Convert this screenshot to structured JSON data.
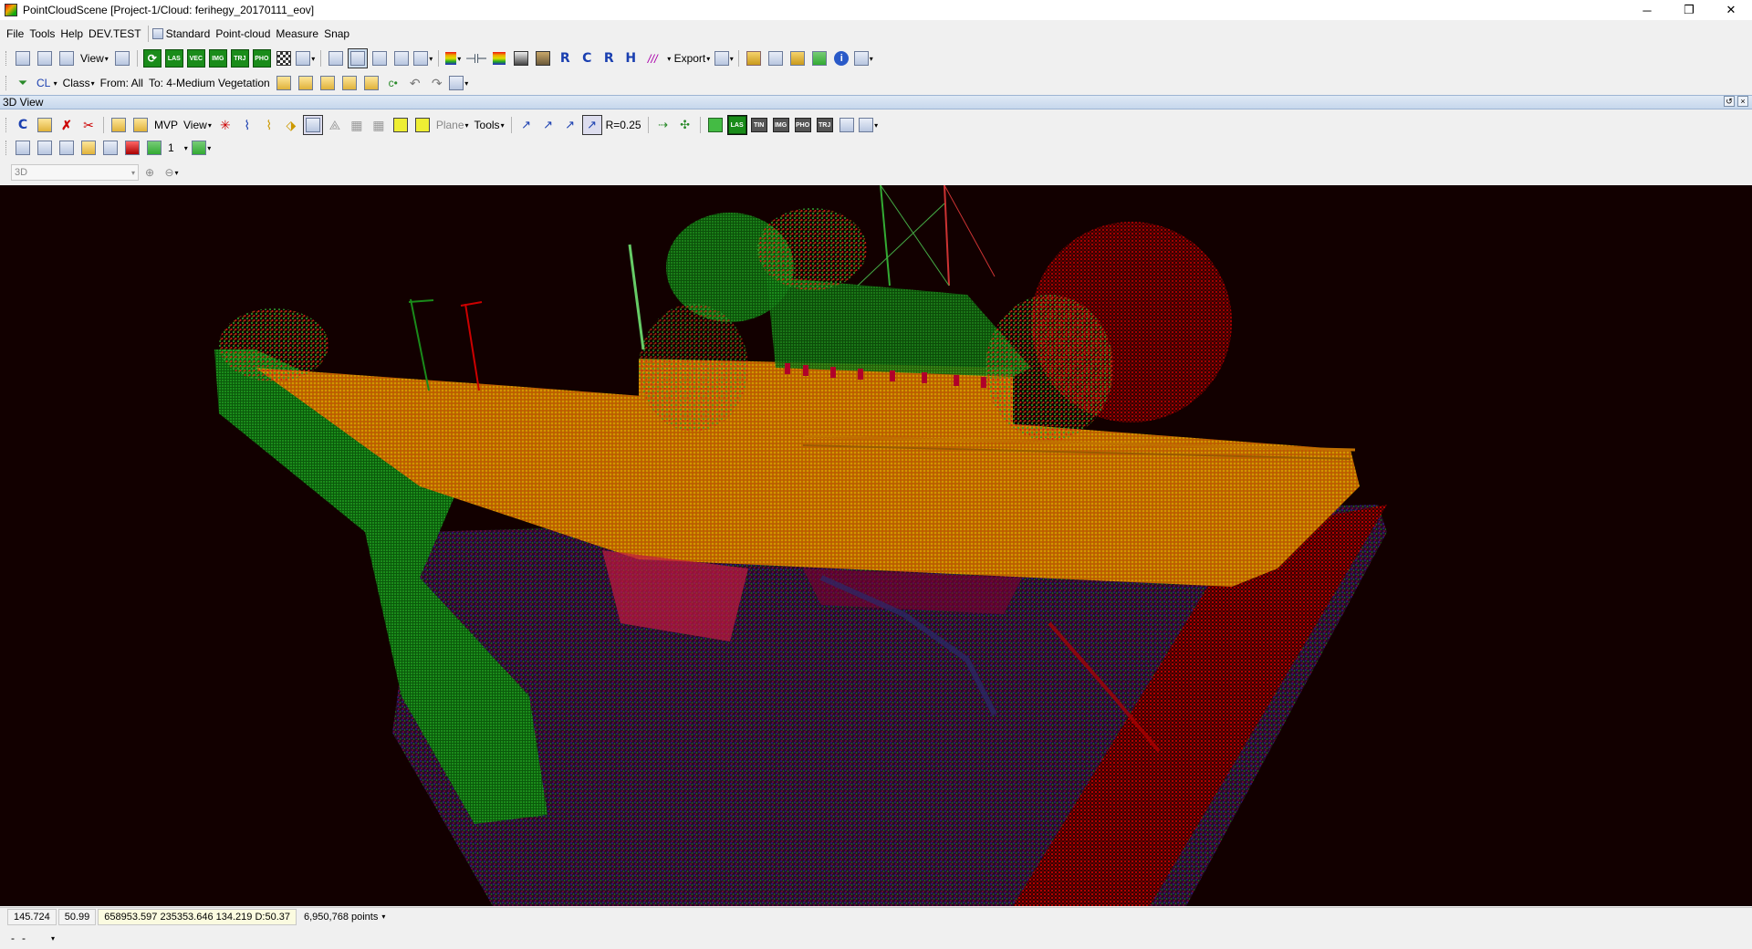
{
  "window": {
    "title": "PointCloudScene  [Project-1/Cloud: ferihegy_20170111_eov]",
    "minimize": "─",
    "restore": "❐",
    "close": "✕"
  },
  "menu": {
    "items": [
      "File",
      "Tools",
      "Help",
      "DEV.TEST"
    ],
    "toolbars": [
      "Standard",
      "Point-cloud",
      "Measure",
      "Snap"
    ]
  },
  "toolbar1": {
    "view_label": "View",
    "data_buttons": [
      "LAS",
      "VEC",
      "IMG",
      "TRJ",
      "PHO"
    ],
    "letters": [
      "R",
      "C",
      "R",
      "H"
    ],
    "export_label": "Export"
  },
  "toolbar2": {
    "cl_label": "CL",
    "class_label": "Class",
    "from_label": "From: All",
    "to_label": "To: 4-Medium Vegetation"
  },
  "panel": {
    "title": "3D View"
  },
  "view_toolbar": {
    "c_label": "C",
    "mvp_label": "MVP",
    "view_label": "View",
    "plane_label": "Plane",
    "tools_label": "Tools",
    "radius_label": "R=0.25",
    "data_buttons": [
      "LAS",
      "TIN",
      "IMG",
      "PHO",
      "TRJ"
    ],
    "active_data": "LAS"
  },
  "view_toolbar2": {
    "count_value": "1"
  },
  "view_toolbar3": {
    "mode_value": "3D"
  },
  "status": {
    "value1": "145.724",
    "value2": "50.99",
    "coords": "658953.597 235353.646 134.219 D:50.37",
    "points": "6,950,768 points"
  },
  "status2": {
    "item1": "-",
    "item2": "-"
  },
  "colors": {
    "viewport_bg": "#120000",
    "green_button": "#1a8c1a",
    "panel_header": "#c6d7ec"
  }
}
